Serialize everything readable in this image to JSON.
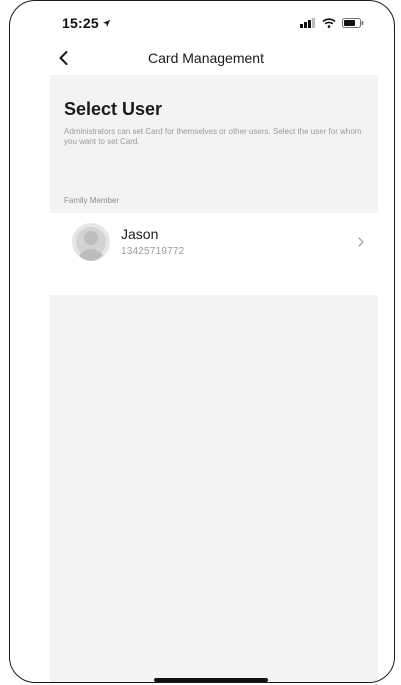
{
  "status_bar": {
    "time": "15:25",
    "location_icon": "location-arrow-icon",
    "signal_icon": "cellular-signal-icon",
    "wifi_icon": "wifi-icon",
    "battery_icon": "battery-icon"
  },
  "nav": {
    "title": "Card Management",
    "back_icon": "chevron-left-icon"
  },
  "header": {
    "title": "Select User",
    "description": "Administrators can set Card for themselves or other users. Select the user for whom you want to set Card."
  },
  "section": {
    "label": "Family Member"
  },
  "users": [
    {
      "name": "Jason",
      "phone": "13425719772",
      "avatar_icon": "default-avatar-icon",
      "chevron_icon": "chevron-right-icon"
    }
  ],
  "colors": {
    "background": "#f2f3f3",
    "row": "#ffffff",
    "text": "#1a1a1a",
    "muted": "#9a9a9a"
  }
}
